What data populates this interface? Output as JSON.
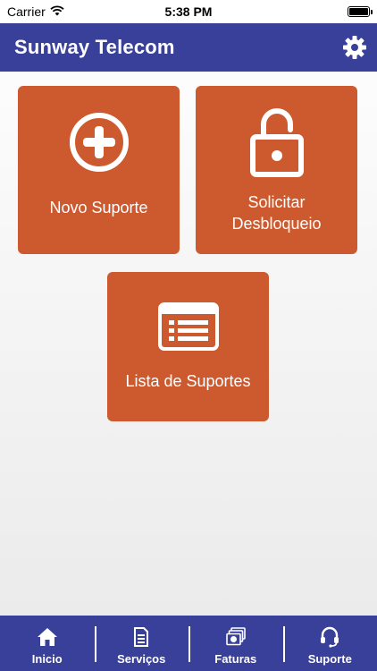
{
  "status_bar": {
    "carrier": "Carrier",
    "time": "5:38 PM"
  },
  "header": {
    "title": "Sunway Telecom"
  },
  "tiles": [
    {
      "label": "Novo Suporte",
      "icon": "plus-circle-icon"
    },
    {
      "label_line1": "Solicitar",
      "label_line2": "Desbloqueio",
      "icon": "unlock-icon"
    },
    {
      "label": "Lista de Suportes",
      "icon": "list-icon"
    }
  ],
  "tab_bar": {
    "tabs": [
      {
        "label": "Inicio",
        "icon": "home-icon"
      },
      {
        "label": "Serviços",
        "icon": "document-icon"
      },
      {
        "label": "Faturas",
        "icon": "money-icon"
      },
      {
        "label": "Suporte",
        "icon": "headset-icon"
      }
    ]
  },
  "colors": {
    "primary": "#38409a",
    "tile": "#cd5a2e",
    "text_light": "#ffffff"
  }
}
